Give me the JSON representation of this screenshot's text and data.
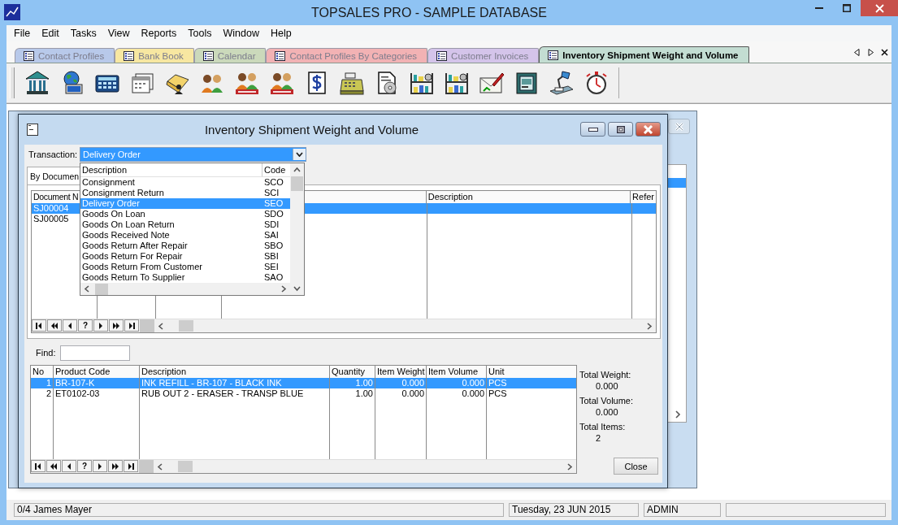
{
  "window": {
    "title": "TOPSALES PRO - SAMPLE DATABASE"
  },
  "menu": [
    "File",
    "Edit",
    "Tasks",
    "View",
    "Reports",
    "Tools",
    "Window",
    "Help"
  ],
  "tabs": [
    {
      "label": "Contact Profiles",
      "color": "#b8c9ea",
      "selected": false
    },
    {
      "label": "Bank Book",
      "color": "#f7e7a1",
      "selected": false
    },
    {
      "label": "Calendar",
      "color": "#cbd9bb",
      "selected": false
    },
    {
      "label": "Contact Profiles By Categories",
      "color": "#f2b2b4",
      "selected": false
    },
    {
      "label": "Customer Invoices",
      "color": "#d4c4ea",
      "selected": false
    },
    {
      "label": "Inventory Shipment Weight and Volume",
      "color": "#c3ddd2",
      "selected": true
    }
  ],
  "toolbar": [
    {
      "kind": "bank"
    },
    {
      "kind": "globe"
    },
    {
      "kind": "calculator"
    },
    {
      "kind": "calendar"
    },
    {
      "kind": "folder"
    },
    {
      "kind": "people"
    },
    {
      "kind": "people_badge"
    },
    {
      "kind": "people_badge"
    },
    {
      "kind": "dollar_doc"
    },
    {
      "kind": "register"
    },
    {
      "kind": "disc_doc"
    },
    {
      "kind": "shelves"
    },
    {
      "kind": "shelves"
    },
    {
      "kind": "envelope"
    },
    {
      "kind": "safe"
    },
    {
      "kind": "lamp"
    },
    {
      "kind": "stopwatch"
    }
  ],
  "dialog": {
    "title": "Inventory Shipment Weight and Volume",
    "transaction_label": "Transaction:",
    "transaction_value": "Delivery Order",
    "tab": "By Documen",
    "dropdown": {
      "columns": [
        "Description",
        "Code"
      ],
      "rows": [
        {
          "description": "Consignment",
          "code": "SCO",
          "selected": false
        },
        {
          "description": "Consignment Return",
          "code": "SCI",
          "selected": false
        },
        {
          "description": "Delivery Order",
          "code": "SEO",
          "selected": true
        },
        {
          "description": "Goods On Loan",
          "code": "SDO",
          "selected": false
        },
        {
          "description": "Goods On Loan Return",
          "code": "SDI",
          "selected": false
        },
        {
          "description": "Goods Received Note",
          "code": "SAI",
          "selected": false
        },
        {
          "description": "Goods Return After Repair",
          "code": "SBO",
          "selected": false
        },
        {
          "description": "Goods Return For Repair",
          "code": "SBI",
          "selected": false
        },
        {
          "description": "Goods Return From Customer",
          "code": "SEI",
          "selected": false
        },
        {
          "description": "Goods Return To Supplier",
          "code": "SAO",
          "selected": false
        }
      ]
    },
    "documents": {
      "columns": [
        "Document N",
        "Description",
        "Refer"
      ],
      "rows": [
        {
          "document": "SJ00004",
          "selected": true
        },
        {
          "document": "SJ00005",
          "selected": false
        }
      ],
      "navigator": [
        {
          "kind": "first"
        },
        {
          "kind": "fast_back"
        },
        {
          "kind": "back"
        },
        {
          "kind": "help",
          "label": "?"
        },
        {
          "kind": "next"
        },
        {
          "kind": "fast_next"
        },
        {
          "kind": "last"
        }
      ]
    },
    "find_label": "Find:",
    "items": {
      "columns": [
        "No",
        "Product Code",
        "Description",
        "Quantity",
        "Item Weight",
        "Item Volume",
        "Unit"
      ],
      "rows": [
        {
          "no": "1",
          "code": "BR-107-K",
          "description": "INK REFILL - BR-107 - BLACK INK",
          "quantity": "1.00",
          "weight": "0.000",
          "volume": "0.000",
          "unit": "PCS",
          "selected": true
        },
        {
          "no": "2",
          "code": "ET0102-03",
          "description": "RUB OUT 2 - ERASER - TRANSP BLUE",
          "quantity": "1.00",
          "weight": "0.000",
          "volume": "0.000",
          "unit": "PCS",
          "selected": false
        }
      ],
      "navigator": [
        {
          "kind": "first"
        },
        {
          "kind": "fast_back"
        },
        {
          "kind": "back"
        },
        {
          "kind": "help",
          "label": "?"
        },
        {
          "kind": "next"
        },
        {
          "kind": "fast_next"
        },
        {
          "kind": "last"
        }
      ]
    },
    "totals": [
      {
        "label": "Total Weight:",
        "value": "0.000"
      },
      {
        "label": "Total Volume:",
        "value": "0.000"
      },
      {
        "label": "Total Items:",
        "value": "2"
      }
    ],
    "close": "Close"
  },
  "status_bar": [
    "0/4  James Mayer",
    "Tuesday, 23 JUN 2015",
    "ADMIN"
  ]
}
